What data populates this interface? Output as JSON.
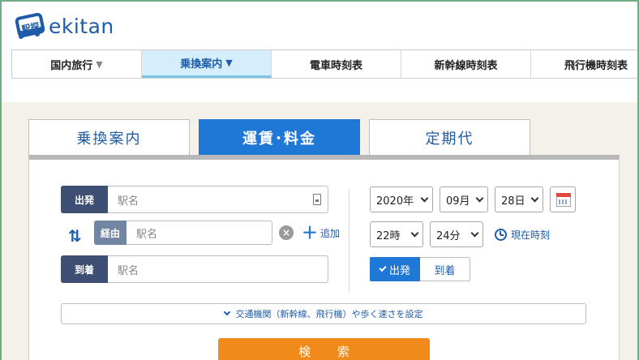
{
  "brand": {
    "name": "ekitan",
    "logo_glyphs": "駅探",
    "color": "#1e5ba8"
  },
  "nav": {
    "items": [
      {
        "label": "国内旅行",
        "has_dropdown": true
      },
      {
        "label": "乗換案内",
        "has_dropdown": true,
        "active": true
      },
      {
        "label": "電車時刻表"
      },
      {
        "label": "新幹線時刻表"
      },
      {
        "label": "飛行機時刻表"
      }
    ]
  },
  "tabs": [
    {
      "label": "乗換案内"
    },
    {
      "label": "運賃･料金",
      "active": true
    },
    {
      "label": "定期代"
    }
  ],
  "form": {
    "departure": {
      "label": "出発",
      "placeholder": "駅名"
    },
    "via": {
      "label": "経由",
      "placeholder": "駅名"
    },
    "add_label": "追加",
    "arrival": {
      "label": "到着",
      "placeholder": "駅名"
    },
    "date": {
      "year": "2020年",
      "month": "09月",
      "day": "28日"
    },
    "time": {
      "hour": "22時",
      "minute": "24分"
    },
    "now_label": "現在時刻",
    "mode": {
      "depart": "出発",
      "arrive": "到着",
      "selected": "出発"
    },
    "advanced_label": "交通機関（新幹線、飛行機）や歩く速さを設定",
    "search_label": "検 索"
  },
  "colors": {
    "primary": "#1f77d6",
    "search": "#f08a1b",
    "label_dark": "#3f4f73",
    "label_via": "#7285a3",
    "frame": "#6fae85"
  }
}
